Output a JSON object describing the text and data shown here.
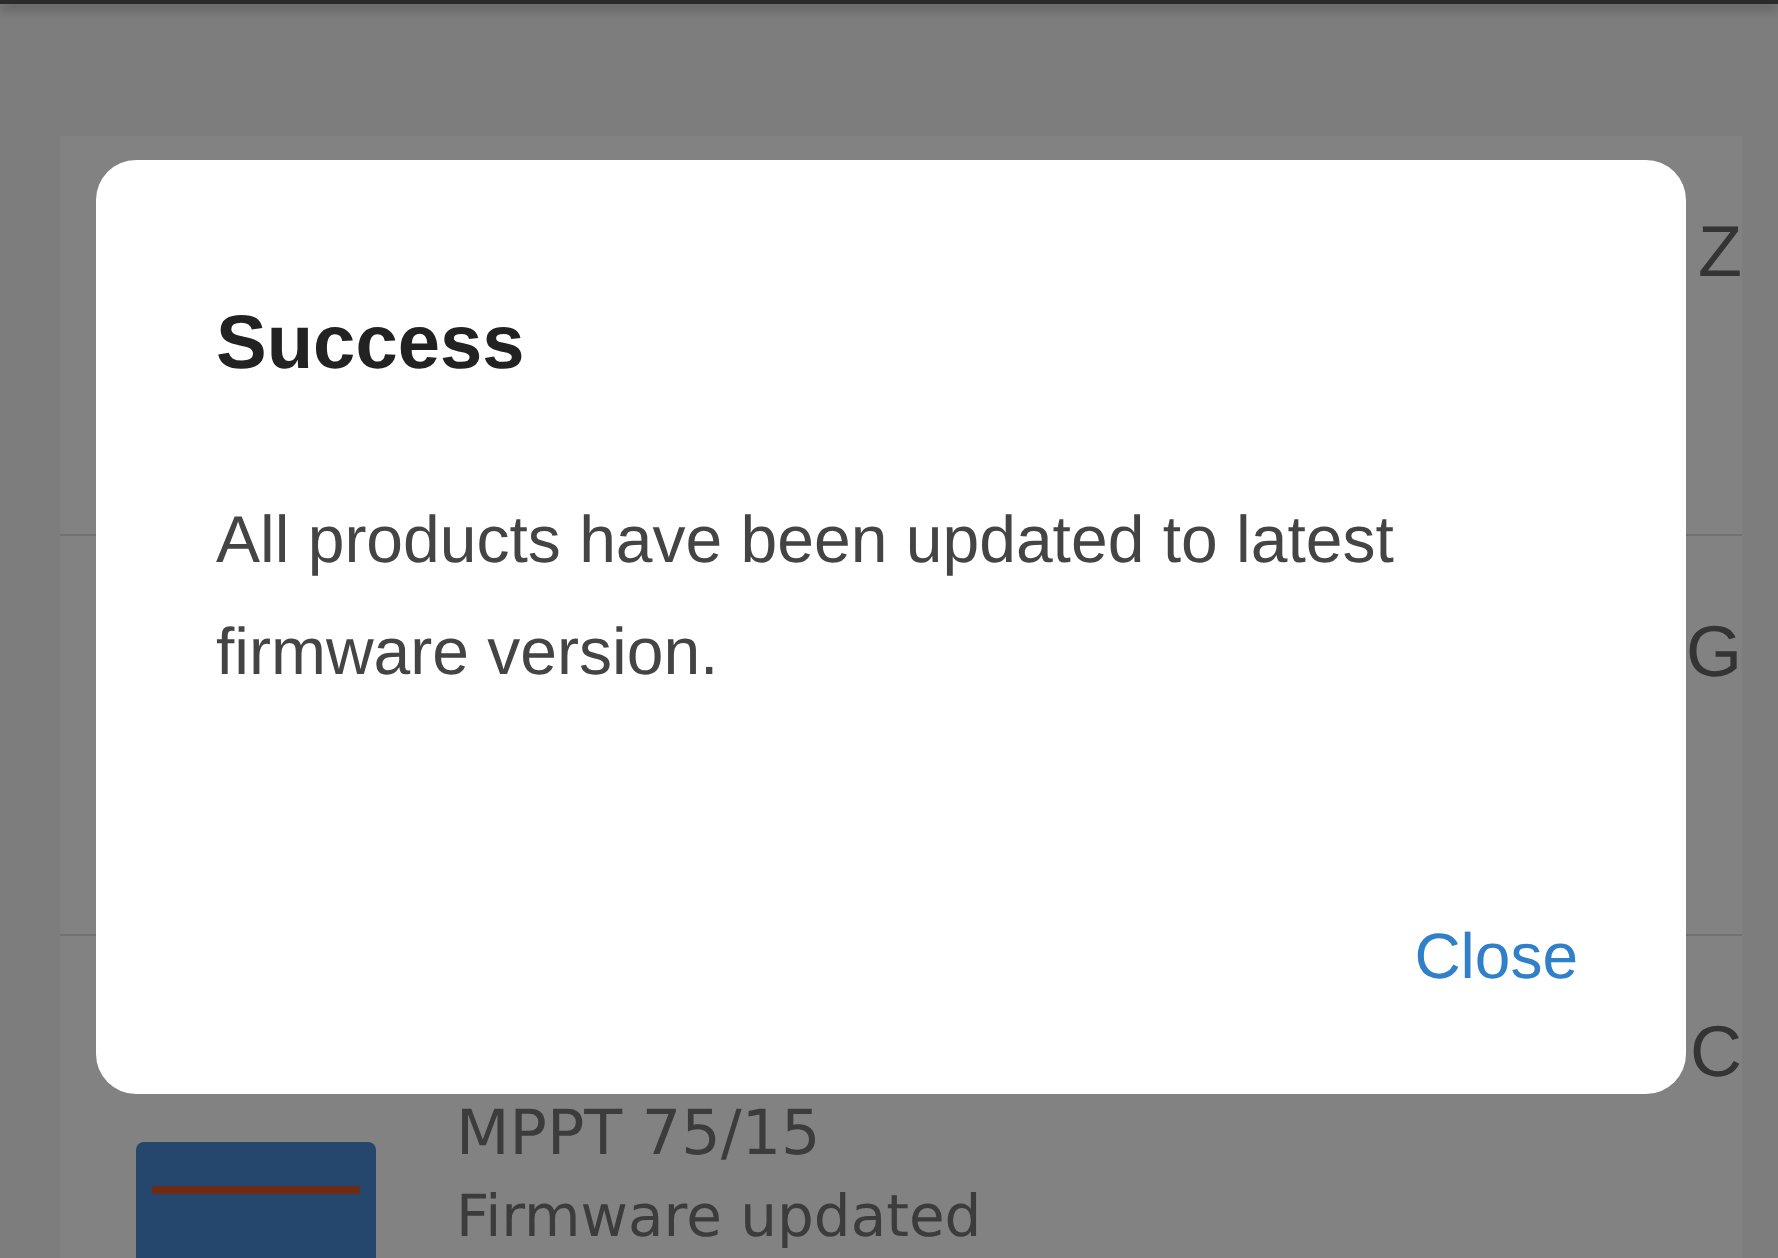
{
  "devices": [
    {
      "title": "Z"
    },
    {
      "title": "G"
    },
    {
      "title": "C",
      "model": "MPPT 75/15",
      "status": "Firmware updated"
    }
  ],
  "dialog": {
    "title": "Success",
    "message": "All products have been updated to latest firmware version.",
    "buttons": [
      "Close"
    ]
  }
}
